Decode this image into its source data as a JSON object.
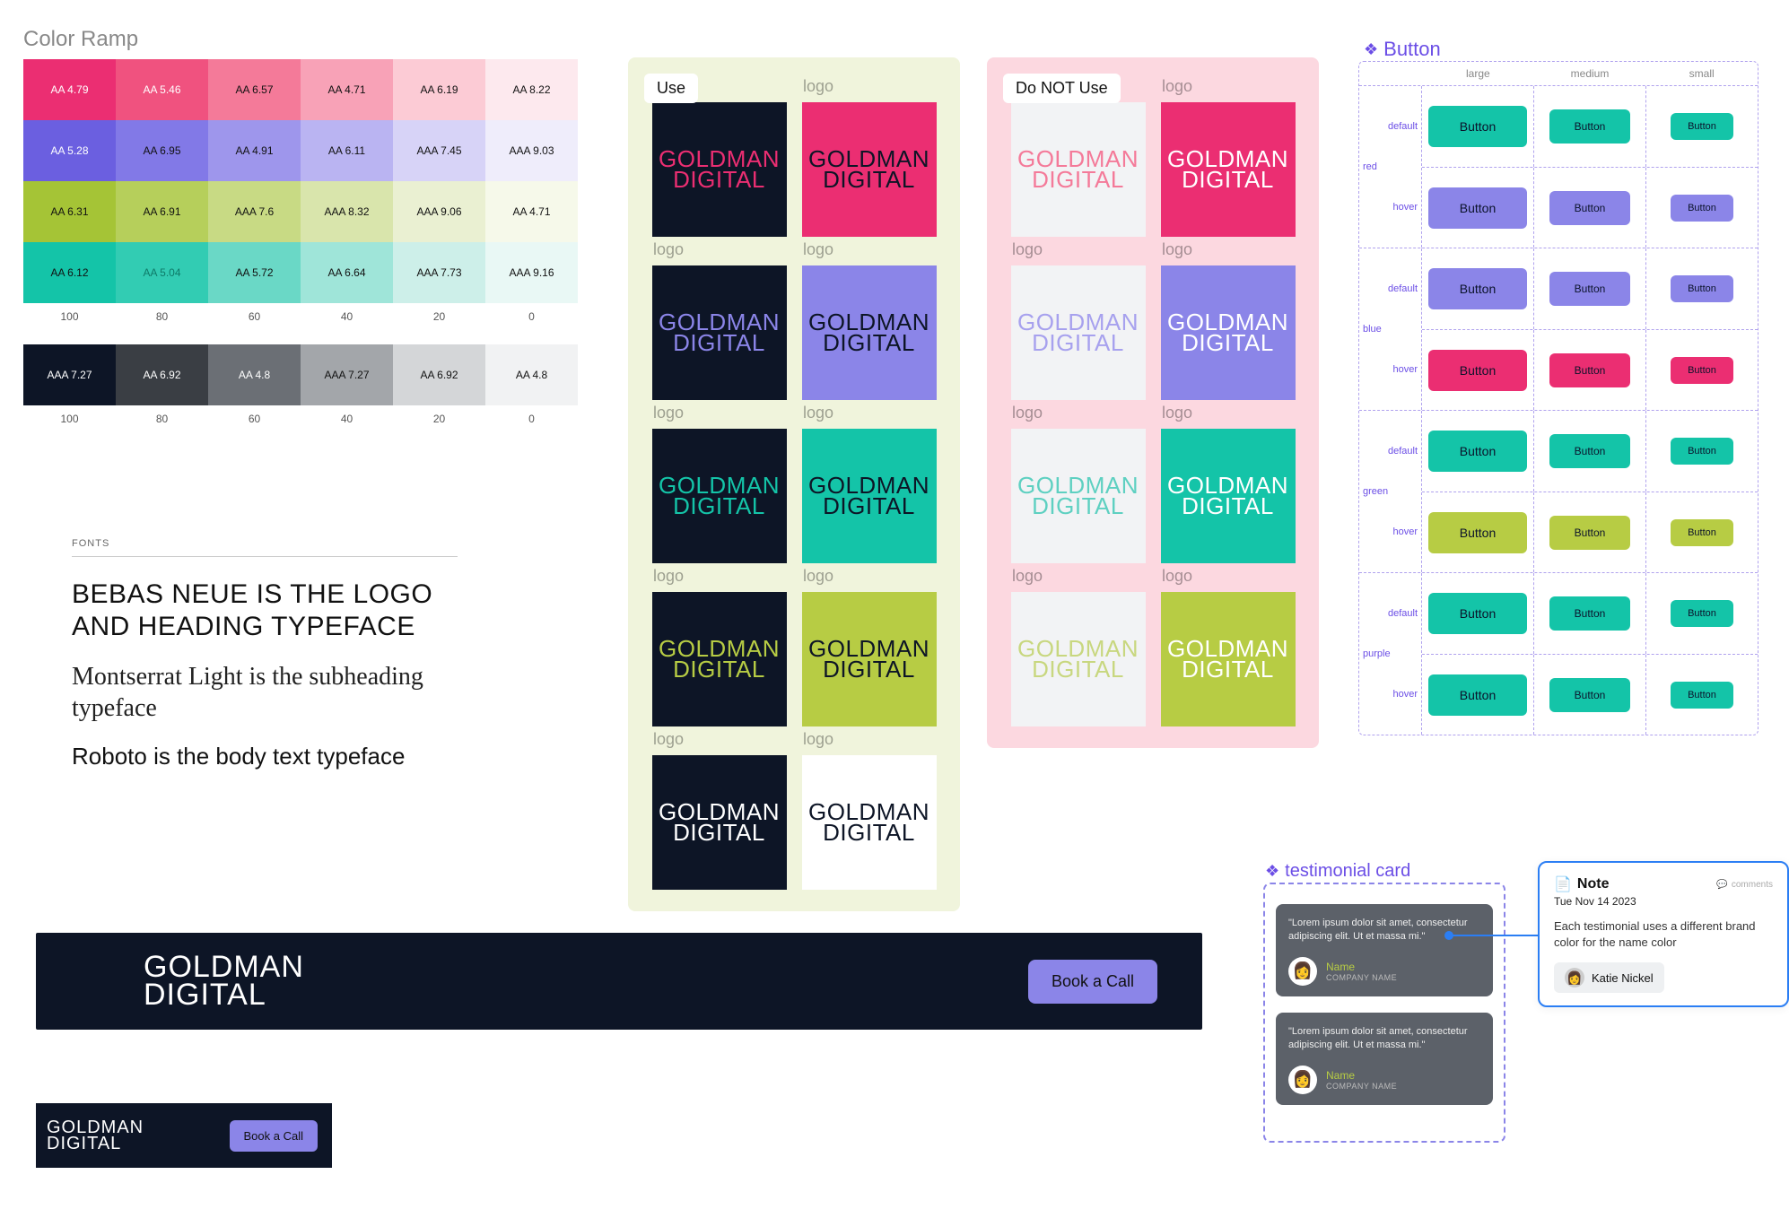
{
  "ramp_title": "Color Ramp",
  "ramp_legend": [
    "100",
    "80",
    "60",
    "40",
    "20",
    "0"
  ],
  "color_rows": [
    {
      "colors": [
        "#eb2e72",
        "#f0527f",
        "#f47a99",
        "#f8a2b7",
        "#fccbd5",
        "#fde9ee"
      ],
      "text": [
        "#fff",
        "#fff",
        "#111",
        "#111",
        "#111",
        "#111"
      ],
      "labels": [
        "AA 4.79",
        "AA 5.46",
        "AA 6.57",
        "AA 4.71",
        "AA 6.19",
        "AA 8.22"
      ]
    },
    {
      "colors": [
        "#6b5fe0",
        "#8279e7",
        "#9e96ec",
        "#bab4f2",
        "#d7d3f7",
        "#efedfb"
      ],
      "text": [
        "#fff",
        "#111",
        "#111",
        "#111",
        "#111",
        "#111"
      ],
      "labels": [
        "AA 5.28",
        "AA 6.95",
        "AA 4.91",
        "AA 6.11",
        "AAA 7.45",
        "AAA 9.03"
      ]
    },
    {
      "colors": [
        "#a5c436",
        "#b6cf5b",
        "#c8da84",
        "#d9e5ac",
        "#eaf0d2",
        "#f6f9ea"
      ],
      "text": [
        "#111",
        "#111",
        "#111",
        "#111",
        "#111",
        "#111"
      ],
      "labels": [
        "AA 6.31",
        "AA 6.91",
        "AAA 7.6",
        "AAA 8.32",
        "AAA 9.06",
        "AA 4.71"
      ]
    },
    {
      "colors": [
        "#14c4a8",
        "#32ccb3",
        "#6ad8c6",
        "#9fe5d9",
        "#cdefe9",
        "#e9f8f5"
      ],
      "text": [
        "#111",
        "#0e7a68",
        "#111",
        "#111",
        "#111",
        "#111"
      ],
      "labels": [
        "AA 6.12",
        "AA 5.04",
        "AA 5.72",
        "AA 6.64",
        "AAA 7.73",
        "AAA 9.16"
      ]
    }
  ],
  "gray_row": {
    "colors": [
      "#0d1526",
      "#3a3e44",
      "#6b6f75",
      "#a3a6aa",
      "#d4d6d8",
      "#f1f2f3"
    ],
    "text": [
      "#fff",
      "#fff",
      "#fff",
      "#111",
      "#111",
      "#111"
    ],
    "labels": [
      "AAA 7.27",
      "AA 6.92",
      "AA 4.8",
      "AAA 7.27",
      "AA 6.92",
      "AA 4.8"
    ]
  },
  "fonts": {
    "label": "FONTS",
    "heading": "Bebas Neue is the logo and heading typeface",
    "subheading": "Montserrat Light is the subheading typeface",
    "body": "Roboto is the body text typeface"
  },
  "logo_text": {
    "line1": "GOLDMAN",
    "line2": "DIGITAL"
  },
  "logo_caption": "logo",
  "use_badge": "Use",
  "dontuse_badge": "Do NOT Use",
  "logo_use": [
    {
      "bg": "#0d1526",
      "fg": "#eb2e72"
    },
    {
      "bg": "#eb2e72",
      "fg": "#0d1526"
    },
    {
      "bg": "#0d1526",
      "fg": "#8b85e8"
    },
    {
      "bg": "#8b85e8",
      "fg": "#0d1526"
    },
    {
      "bg": "#0d1526",
      "fg": "#14c4a8"
    },
    {
      "bg": "#14c4a8",
      "fg": "#0d1526"
    },
    {
      "bg": "#0d1526",
      "fg": "#b7cc44"
    },
    {
      "bg": "#b7cc44",
      "fg": "#0d1526"
    },
    {
      "bg": "#0d1526",
      "fg": "#ffffff"
    },
    {
      "bg": "#ffffff",
      "fg": "#0d1526"
    }
  ],
  "logo_dontuse": [
    {
      "bg": "#f2f3f5",
      "fg": "#f47a99"
    },
    {
      "bg": "#eb2e72",
      "fg": "#ffffff"
    },
    {
      "bg": "#f2f3f5",
      "fg": "#a7a1ee"
    },
    {
      "bg": "#8b85e8",
      "fg": "#ffffff"
    },
    {
      "bg": "#f2f3f5",
      "fg": "#5ed0c1"
    },
    {
      "bg": "#14c4a8",
      "fg": "#ffffff"
    },
    {
      "bg": "#f2f3f5",
      "fg": "#c8d77f"
    },
    {
      "bg": "#b7cc44",
      "fg": "#ffffff"
    }
  ],
  "buttons": {
    "title": "Button",
    "sizes": [
      "large",
      "medium",
      "small"
    ],
    "label": "Button",
    "groups": [
      {
        "name": "red",
        "default": "#14c4a8",
        "hover": "#8b85e8"
      },
      {
        "name": "blue",
        "default": "#8b85e8",
        "hover": "#eb2e72"
      },
      {
        "name": "green",
        "default": "#14c4a8",
        "hover": "#b7cc44"
      },
      {
        "name": "purple",
        "default": "#14c4a8",
        "hover": "#14c4a8"
      }
    ],
    "state_labels": {
      "default": "default",
      "hover": "hover"
    }
  },
  "nav": {
    "cta": "Book a Call"
  },
  "testimonial": {
    "title": "testimonial card",
    "cards": [
      {
        "quote": "\"Lorem ipsum dolor sit amet, consectetur adipiscing elit. Ut et massa mi.\"",
        "name": "Name",
        "company": "COMPANY NAME"
      },
      {
        "quote": "\"Lorem ipsum dolor sit amet, consectetur adipiscing elit. Ut et massa mi.\"",
        "name": "Name",
        "company": "COMPANY NAME"
      }
    ]
  },
  "note": {
    "title": "Note",
    "date": "Tue Nov 14 2023",
    "body": "Each testimonial uses a different brand color for the name color",
    "author": "Katie Nickel",
    "comments": "comments"
  }
}
